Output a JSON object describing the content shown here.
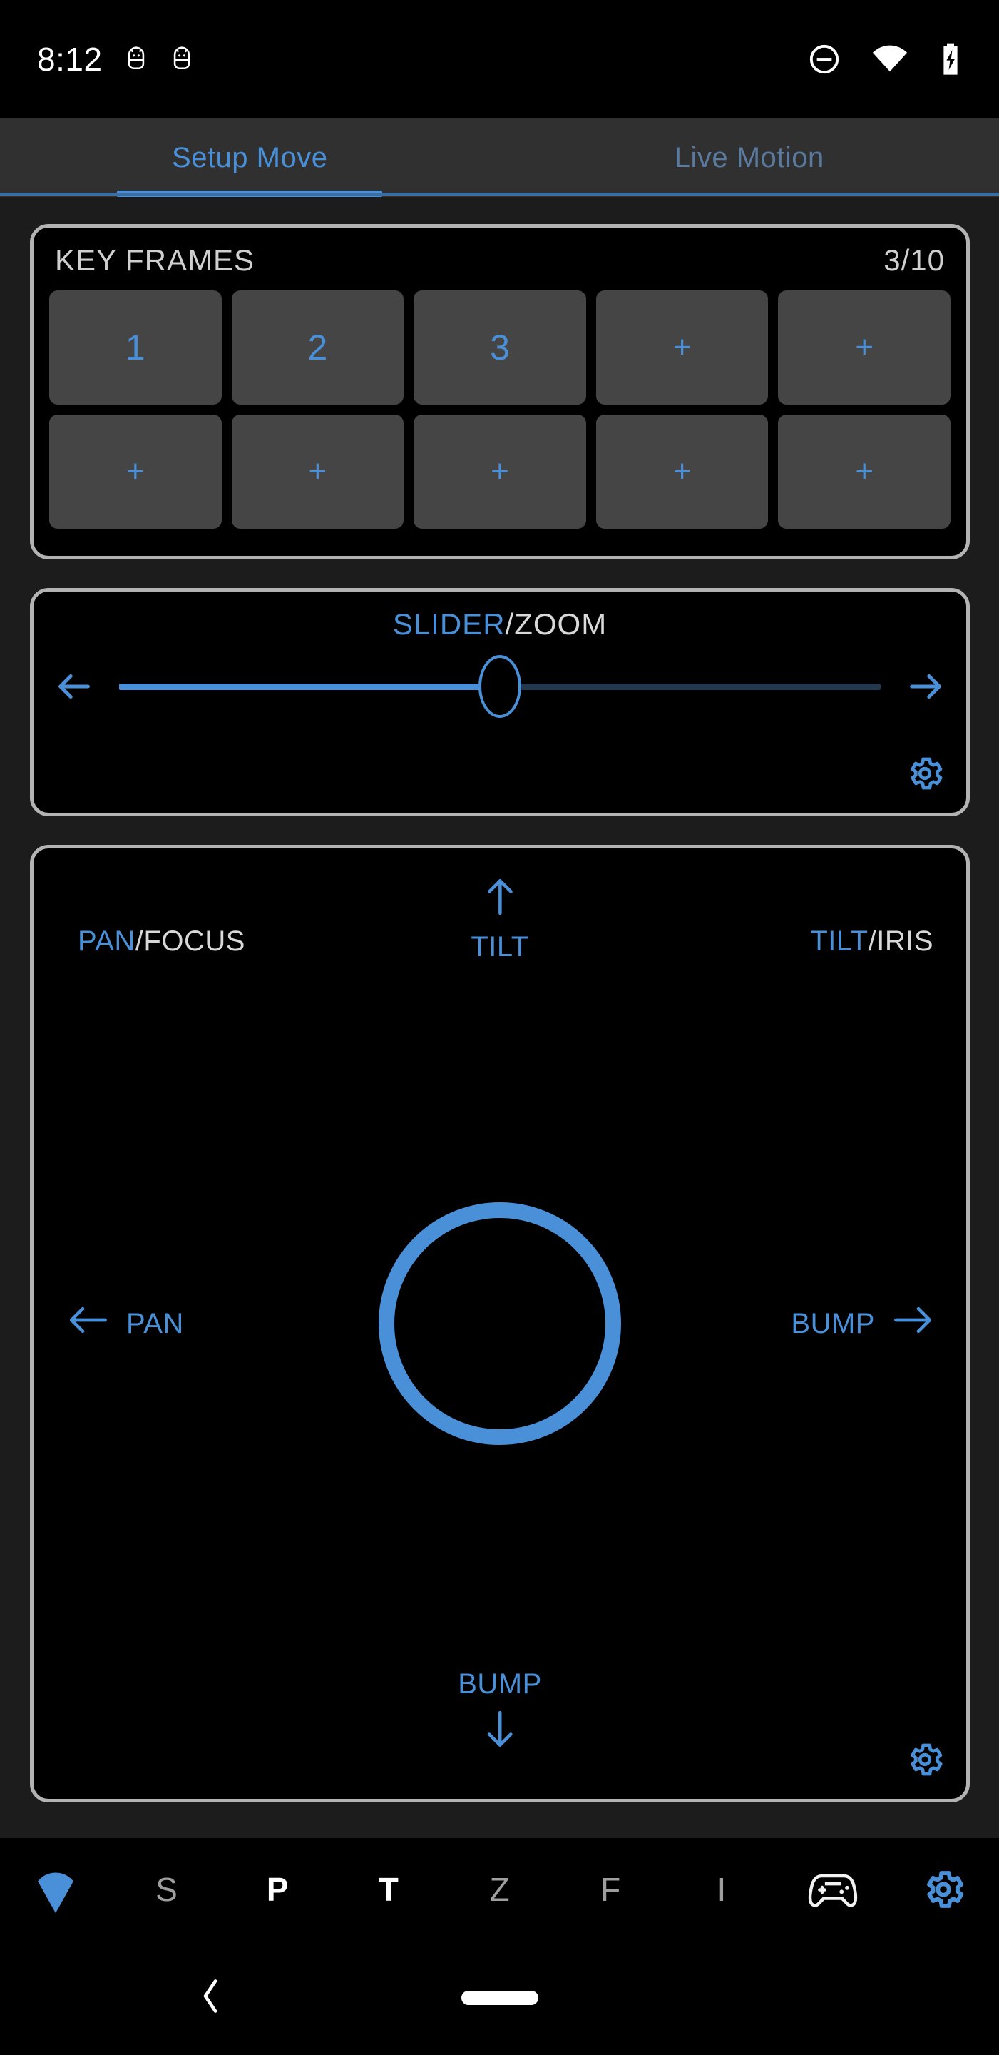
{
  "status_bar": {
    "time": "8:12",
    "left_icons": [
      "android-debug-icon",
      "android-debug-icon"
    ],
    "right_icons": [
      "do-not-disturb-icon",
      "wifi-icon",
      "battery-charging-icon"
    ]
  },
  "tabs": [
    {
      "label": "Setup Move",
      "active": true
    },
    {
      "label": "Live Motion",
      "active": false
    }
  ],
  "keyframes": {
    "title": "KEY FRAMES",
    "count": "3/10",
    "buttons": [
      {
        "label": "1",
        "type": "frame"
      },
      {
        "label": "2",
        "type": "frame"
      },
      {
        "label": "3",
        "type": "frame"
      },
      {
        "label": "+",
        "type": "add"
      },
      {
        "label": "+",
        "type": "add"
      },
      {
        "label": "+",
        "type": "add"
      },
      {
        "label": "+",
        "type": "add"
      },
      {
        "label": "+",
        "type": "add"
      },
      {
        "label": "+",
        "type": "add"
      },
      {
        "label": "+",
        "type": "add"
      }
    ]
  },
  "slider_panel": {
    "title_primary": "SLIDER",
    "title_secondary": "/ZOOM",
    "left_arrow": "arrow-left-icon",
    "right_arrow": "arrow-right-icon",
    "value_percent": 50,
    "gear": "gear-icon"
  },
  "joystick_panel": {
    "top_left_primary": "PAN",
    "top_left_secondary": "/FOCUS",
    "top_right_primary": "TILT",
    "top_right_secondary": "/IRIS",
    "top_center_label": "TILT",
    "left_label": "PAN",
    "right_label": "BUMP",
    "bottom_label": "BUMP",
    "gear": "gear-icon"
  },
  "toolbar": {
    "items": [
      {
        "label": "",
        "icon": "wifi-location-icon",
        "state": "accent"
      },
      {
        "label": "S",
        "icon": "",
        "state": "dim"
      },
      {
        "label": "P",
        "icon": "",
        "state": "bright"
      },
      {
        "label": "T",
        "icon": "",
        "state": "bright"
      },
      {
        "label": "Z",
        "icon": "",
        "state": "dim"
      },
      {
        "label": "F",
        "icon": "",
        "state": "dim"
      },
      {
        "label": "I",
        "icon": "",
        "state": "dim"
      },
      {
        "label": "",
        "icon": "gamepad-icon",
        "state": "bright"
      },
      {
        "label": "",
        "icon": "gear-icon",
        "state": "accent"
      }
    ]
  },
  "nav_bar": {
    "back": "back-chevron-icon",
    "home": "home-pill-icon"
  },
  "colors": {
    "accent": "#4a90d9",
    "accent_dim": "#21384f",
    "background": "#000000",
    "panel_border": "#b3b3b3",
    "page_background": "#1c1c1c",
    "tabbar_background": "#303030",
    "text_light": "#d9d9d9",
    "text_dim": "#9e9e9e",
    "keyframe_button": "#454545"
  }
}
